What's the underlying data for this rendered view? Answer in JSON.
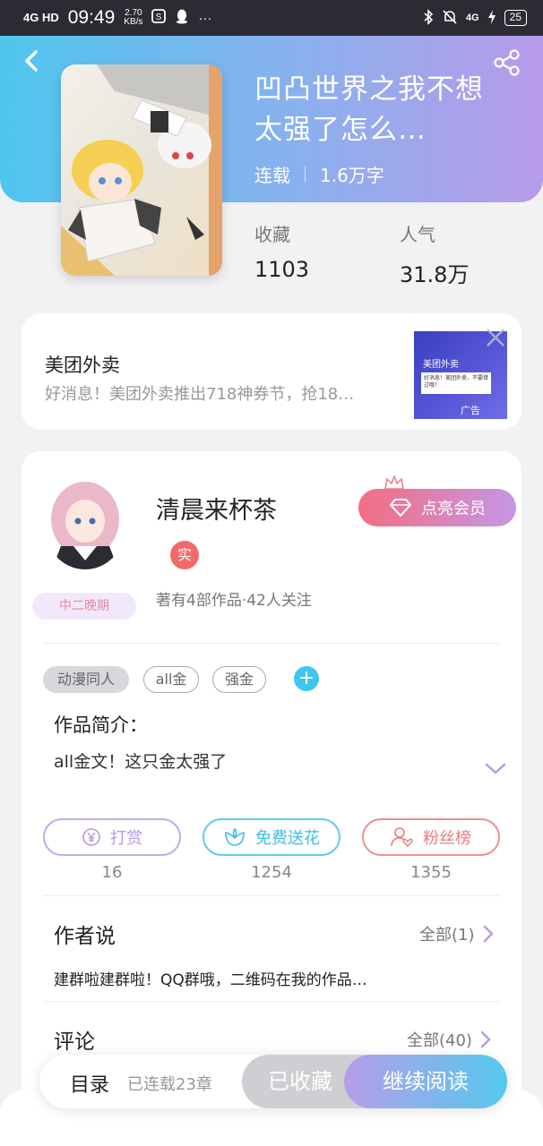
{
  "status_bar": {
    "network": "4G HD",
    "time": "09:49",
    "speed_value": "2.70",
    "speed_unit": "KB/s",
    "more": "···",
    "battery": "25",
    "right_network": "4G"
  },
  "header": {
    "title": "凹凸世界之我不想太强了怎么…",
    "status": "连载",
    "word_count": "1.6万字",
    "stats": [
      {
        "label": "收藏",
        "value": "1103"
      },
      {
        "label": "人气",
        "value": "31.8万"
      }
    ]
  },
  "ad": {
    "title": "美团外卖",
    "description": "好消息！美团外卖推出718神券节，抢18…",
    "image_title": "美团外卖",
    "image_text": "好消息！美团外卖，不要错过哦！",
    "image_tag": "广告"
  },
  "author": {
    "name": "清晨来杯茶",
    "verified_label": "实",
    "level": "中二晚期",
    "stats": "著有4部作品·42人关注",
    "vip_button": "点亮会员"
  },
  "tags": [
    "动漫同人",
    "all金",
    "强金"
  ],
  "add_tag": "+",
  "intro": {
    "label": "作品简介：",
    "text": "all金文！这只金太强了"
  },
  "actions": [
    {
      "label": "打赏",
      "count": "16",
      "color": "#b99be6"
    },
    {
      "label": "免费送花",
      "count": "1254",
      "color": "#46c6ee"
    },
    {
      "label": "粉丝榜",
      "count": "1355",
      "color": "#ee8080"
    }
  ],
  "author_say": {
    "title": "作者说",
    "link": "全部(1)",
    "text": "建群啦建群啦！QQ群哦，二维码在我的作品…"
  },
  "comments": {
    "title": "评论",
    "link": "全部(40)"
  },
  "bottom_bar": {
    "toc": "目录",
    "serial": "已连载23章",
    "collected": "已收藏",
    "continue": "继续阅读"
  }
}
